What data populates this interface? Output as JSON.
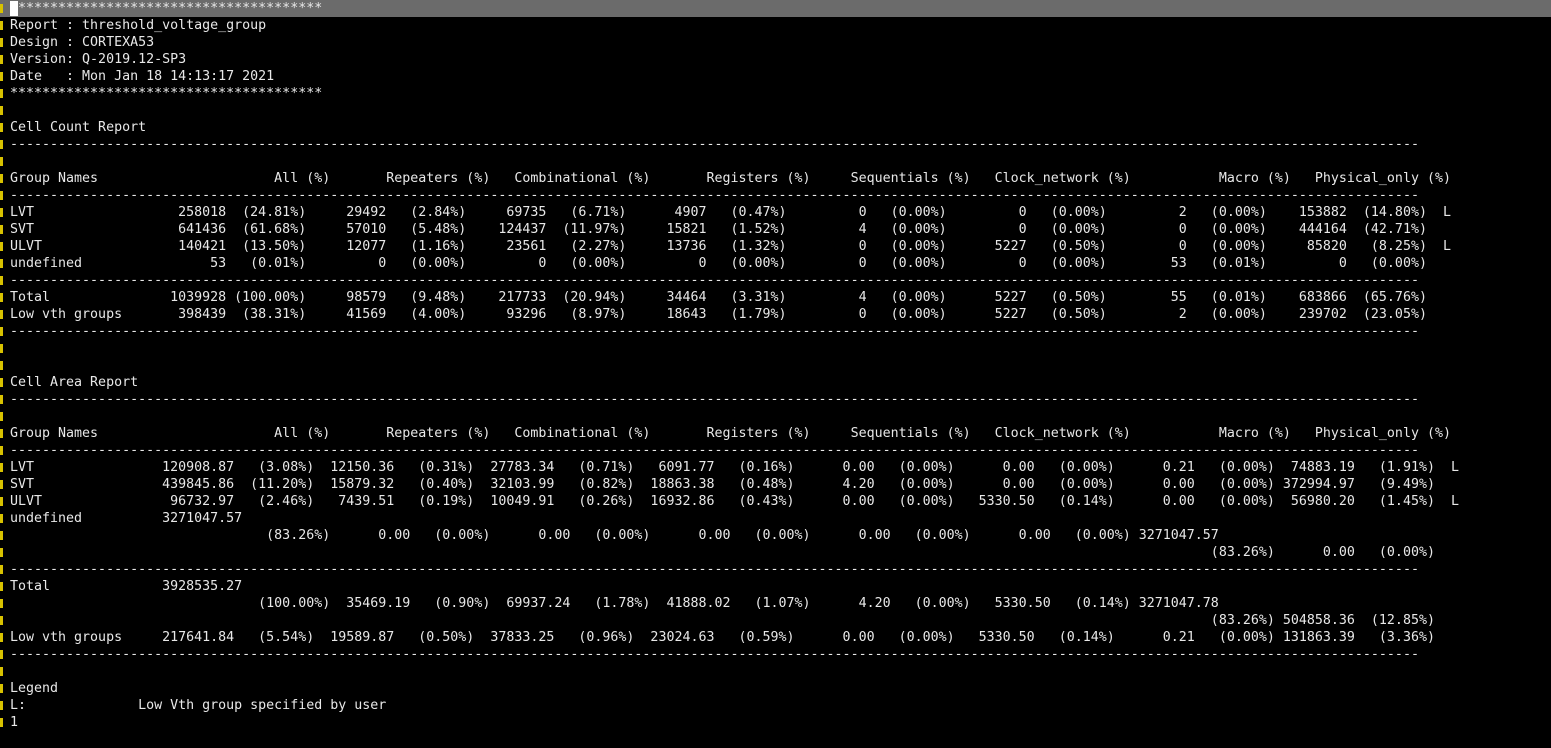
{
  "terminal": {
    "colors": {
      "background": "#000000",
      "text": "#e8e8e8",
      "top_bar": "#6b6b6b",
      "gutter_marker": "#d8c200"
    },
    "lines": [
      "***************************************",
      "Report : threshold_voltage_group",
      "Design : CORTEXA53",
      "Version: Q-2019.12-SP3",
      "Date   : Mon Jan 18 14:13:17 2021",
      "***************************************",
      "",
      "Cell Count Report",
      "--------------------------------------------------------------------------------------------------------------------------------------------------------------------------------",
      "",
      "Group Names                      All (%)       Repeaters (%)   Combinational (%)       Registers (%)     Sequentials (%)   Clock_network (%)           Macro (%)   Physical_only (%)",
      "--------------------------------------------------------------------------------------------------------------------------------------------------------------------------------",
      "LVT                  258018  (24.81%)     29492   (2.84%)     69735   (6.71%)      4907   (0.47%)         0   (0.00%)         0   (0.00%)         2   (0.00%)    153882  (14.80%)  L",
      "SVT                  641436  (61.68%)     57010   (5.48%)    124437  (11.97%)     15821   (1.52%)         4   (0.00%)         0   (0.00%)         0   (0.00%)    444164  (42.71%)",
      "ULVT                 140421  (13.50%)     12077   (1.16%)     23561   (2.27%)     13736   (1.32%)         0   (0.00%)      5227   (0.50%)         0   (0.00%)     85820   (8.25%)  L",
      "undefined                53   (0.01%)         0   (0.00%)         0   (0.00%)         0   (0.00%)         0   (0.00%)         0   (0.00%)        53   (0.01%)         0   (0.00%)",
      "--------------------------------------------------------------------------------------------------------------------------------------------------------------------------------",
      "Total               1039928 (100.00%)     98579   (9.48%)    217733  (20.94%)     34464   (3.31%)         4   (0.00%)      5227   (0.50%)        55   (0.01%)    683866  (65.76%)",
      "Low vth groups       398439  (38.31%)     41569   (4.00%)     93296   (8.97%)     18643   (1.79%)         0   (0.00%)      5227   (0.50%)         2   (0.00%)    239702  (23.05%)",
      "--------------------------------------------------------------------------------------------------------------------------------------------------------------------------------",
      "",
      "",
      "Cell Area Report",
      "--------------------------------------------------------------------------------------------------------------------------------------------------------------------------------",
      "",
      "Group Names                      All (%)       Repeaters (%)   Combinational (%)       Registers (%)     Sequentials (%)   Clock_network (%)           Macro (%)   Physical_only (%)",
      "--------------------------------------------------------------------------------------------------------------------------------------------------------------------------------",
      "LVT                120908.87   (3.08%)  12150.36   (0.31%)  27783.34   (0.71%)   6091.77   (0.16%)      0.00   (0.00%)      0.00   (0.00%)      0.21   (0.00%)  74883.19   (1.91%)  L",
      "SVT                439845.86  (11.20%)  15879.32   (0.40%)  32103.99   (0.82%)  18863.38   (0.48%)      4.20   (0.00%)      0.00   (0.00%)      0.00   (0.00%) 372994.97   (9.49%)",
      "ULVT                96732.97   (2.46%)   7439.51   (0.19%)  10049.91   (0.26%)  16932.86   (0.43%)      0.00   (0.00%)   5330.50   (0.14%)      0.00   (0.00%)  56980.20   (1.45%)  L",
      "undefined          3271047.57",
      "                                (83.26%)      0.00   (0.00%)      0.00   (0.00%)      0.00   (0.00%)      0.00   (0.00%)      0.00   (0.00%) 3271047.57",
      "                                                                                                                                                      (83.26%)      0.00   (0.00%)",
      "--------------------------------------------------------------------------------------------------------------------------------------------------------------------------------",
      "Total              3928535.27",
      "                               (100.00%)  35469.19   (0.90%)  69937.24   (1.78%)  41888.02   (1.07%)      4.20   (0.00%)   5330.50   (0.14%) 3271047.78",
      "                                                                                                                                                      (83.26%) 504858.36  (12.85%)",
      "Low vth groups     217641.84   (5.54%)  19589.87   (0.50%)  37833.25   (0.96%)  23024.63   (0.59%)      0.00   (0.00%)   5330.50   (0.14%)      0.21   (0.00%) 131863.39   (3.36%)",
      "--------------------------------------------------------------------------------------------------------------------------------------------------------------------------------",
      "",
      "Legend",
      "L:              Low Vth group specified by user",
      "1"
    ]
  }
}
